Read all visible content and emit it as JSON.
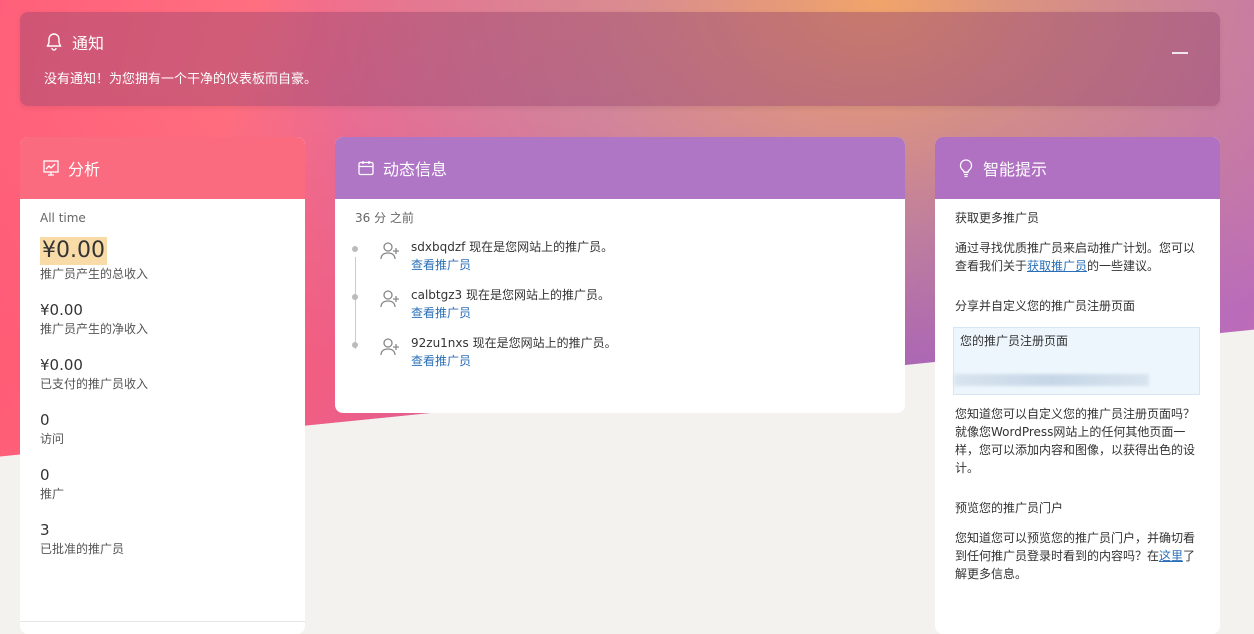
{
  "notice": {
    "title": "通知",
    "message": "没有通知！为您拥有一个干净的仪表板而自豪。",
    "icon": "bell-icon"
  },
  "analytics": {
    "title": "分析",
    "icon": "chart-icon",
    "period": "All time",
    "stats": [
      {
        "value": "¥0.00",
        "label": "推广员产生的总收入"
      },
      {
        "value": "¥0.00",
        "label": "推广员产生的净收入"
      },
      {
        "value": "¥0.00",
        "label": "已支付的推广员收入"
      },
      {
        "value": "0",
        "label": "访问"
      },
      {
        "value": "0",
        "label": "推广"
      },
      {
        "value": "3",
        "label": "已批准的推广员"
      }
    ]
  },
  "activity": {
    "title": "动态信息",
    "icon": "calendar-icon",
    "time": "36 分 之前",
    "items": [
      {
        "user": "sdxbqdzf",
        "text": " 现在是您网站上的推广员。",
        "link": "查看推广员"
      },
      {
        "user": "calbtgz3",
        "text": " 现在是您网站上的推广员。",
        "link": "查看推广员"
      },
      {
        "user": "92zu1nxs",
        "text": " 现在是您网站上的推广员。",
        "link": "查看推广员"
      }
    ]
  },
  "tips": {
    "title": "智能提示",
    "icon": "lightbulb-icon",
    "sections": [
      {
        "heading": "获取更多推广员",
        "pre": "通过寻找优质推广员来启动推广计划。您可以查看我们关于",
        "link": "获取推广员",
        "post": "的一些建议。"
      },
      {
        "heading": "分享并自定义您的推广员注册页面",
        "box_label": "您的推广员注册页面",
        "body": "您知道您可以自定义您的推广员注册页面吗？就像您WordPress网站上的任何其他页面一样，您可以添加内容和图像，以获得出色的设计。"
      },
      {
        "heading": "预览您的推广员门户",
        "pre": "您知道您可以预览您的推广员门户，并确切看到任何推广员登录时看到的内容吗？在",
        "link": "这里",
        "post": "了解更多信息。"
      }
    ]
  },
  "colors": {
    "analytics_header": "#fb6b7f",
    "activity_header": "#b076c6",
    "tips_header": "#b071c2",
    "link": "#2a6fb8",
    "highlight": "#f9dba8"
  }
}
